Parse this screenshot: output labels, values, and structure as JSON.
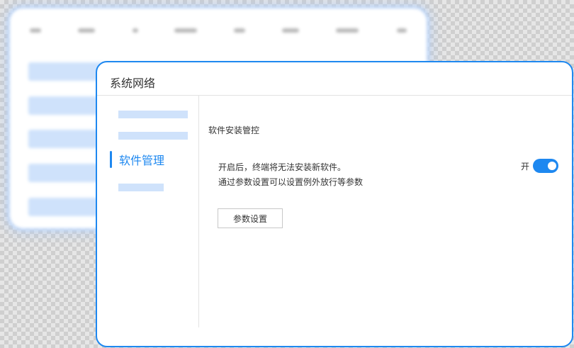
{
  "dialog": {
    "title": "系统网络",
    "sidebar": {
      "active_label": "软件管理"
    },
    "section_title": "软件安装管控",
    "description_line1": "开启后，终端将无法安装新软件。",
    "description_line2": "通过参数设置可以设置例外放行等参数",
    "toggle": {
      "label": "开",
      "on": true
    },
    "param_button_label": "参数设置"
  },
  "colors": {
    "accent": "#1e88f0",
    "placeholder": "#cfe2fb",
    "text": "#333333",
    "divider": "#e3e3e3"
  }
}
